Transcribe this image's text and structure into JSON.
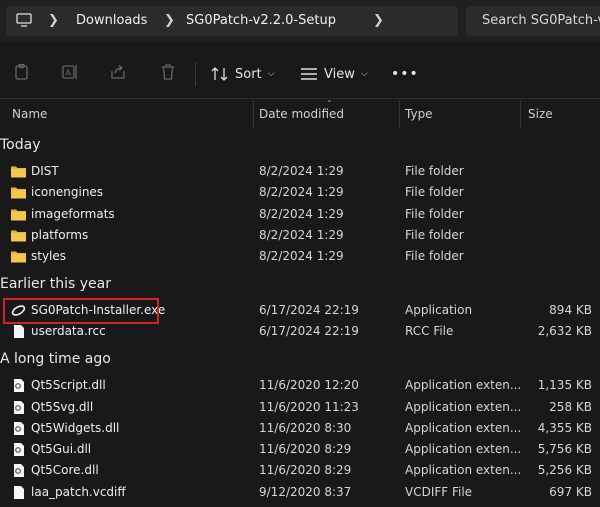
{
  "address": {
    "crumbs": [
      "Downloads",
      "SG0Patch-v2.2.0-Setup"
    ],
    "search_placeholder": "Search SG0Patch-v2.2.0-Setup"
  },
  "toolbar": {
    "icons": [
      "clipboard-icon",
      "rename-icon",
      "share-icon",
      "trash-icon"
    ],
    "sort_label": "Sort",
    "view_label": "View",
    "more_label": "•••"
  },
  "columns": {
    "name": "Name",
    "date": "Date modified",
    "type": "Type",
    "size": "Size"
  },
  "groups": [
    {
      "label": "Today",
      "files": [
        {
          "name": "DIST",
          "date": "8/2/2024 1:29",
          "type": "File folder",
          "size": "",
          "icon": "folder-icon"
        },
        {
          "name": "iconengines",
          "date": "8/2/2024 1:29",
          "type": "File folder",
          "size": "",
          "icon": "folder-icon"
        },
        {
          "name": "imageformats",
          "date": "8/2/2024 1:29",
          "type": "File folder",
          "size": "",
          "icon": "folder-icon"
        },
        {
          "name": "platforms",
          "date": "8/2/2024 1:29",
          "type": "File folder",
          "size": "",
          "icon": "folder-icon"
        },
        {
          "name": "styles",
          "date": "8/2/2024 1:29",
          "type": "File folder",
          "size": "",
          "icon": "folder-icon"
        }
      ]
    },
    {
      "label": "Earlier this year",
      "files": [
        {
          "name": "SG0Patch-Installer.exe",
          "date": "6/17/2024 22:19",
          "type": "Application",
          "size": "894 KB",
          "icon": "app-icon",
          "highlighted": true
        },
        {
          "name": "userdata.rcc",
          "date": "6/17/2024 22:19",
          "type": "RCC File",
          "size": "2,632 KB",
          "icon": "file-icon"
        }
      ]
    },
    {
      "label": "A long time ago",
      "files": [
        {
          "name": "Qt5Script.dll",
          "date": "11/6/2020 12:20",
          "type": "Application exten...",
          "size": "1,135 KB",
          "icon": "dll-icon"
        },
        {
          "name": "Qt5Svg.dll",
          "date": "11/6/2020 11:23",
          "type": "Application exten...",
          "size": "258 KB",
          "icon": "dll-icon"
        },
        {
          "name": "Qt5Widgets.dll",
          "date": "11/6/2020 8:30",
          "type": "Application exten...",
          "size": "4,355 KB",
          "icon": "dll-icon"
        },
        {
          "name": "Qt5Gui.dll",
          "date": "11/6/2020 8:29",
          "type": "Application exten...",
          "size": "5,756 KB",
          "icon": "dll-icon"
        },
        {
          "name": "Qt5Core.dll",
          "date": "11/6/2020 8:29",
          "type": "Application exten...",
          "size": "5,256 KB",
          "icon": "dll-icon"
        },
        {
          "name": "laa_patch.vcdiff",
          "date": "9/12/2020 8:37",
          "type": "VCDIFF File",
          "size": "697 KB",
          "icon": "file-icon"
        }
      ]
    }
  ]
}
